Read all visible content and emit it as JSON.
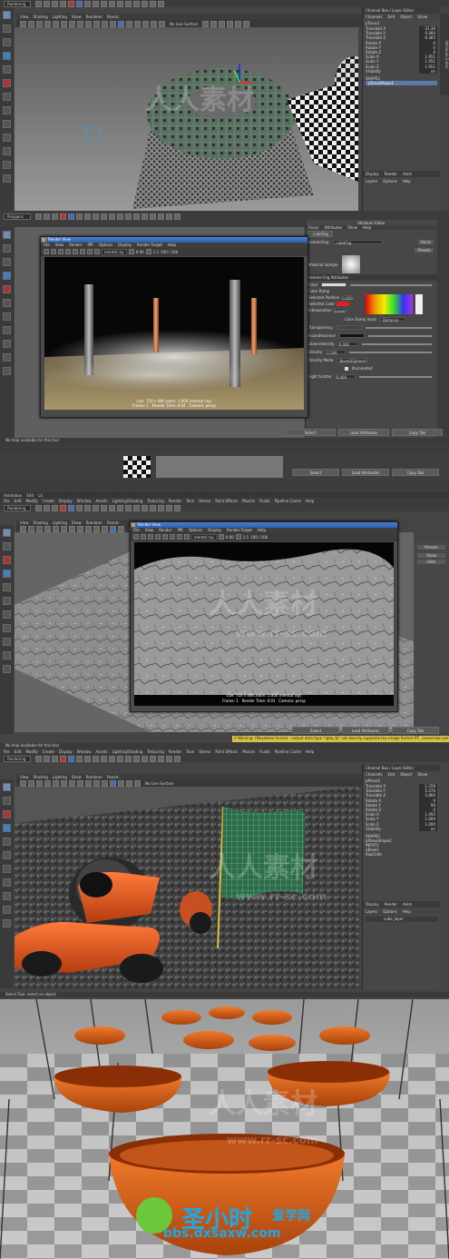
{
  "p1": {
    "mode": "Rendering",
    "menu": [
      "File",
      "Edit",
      "Modify",
      "Create",
      "Display",
      "Window",
      "Assets",
      "Select",
      "Mesh",
      "Edit Mesh",
      "Proxy",
      "Normals",
      "Color",
      "Create UVs",
      "Edit UVs",
      "Muscle",
      "Stereo",
      "Pipeline Cache",
      "Help"
    ],
    "viewmenu": [
      "View",
      "Shading",
      "Lighting",
      "Show",
      "Renderer",
      "Panels"
    ],
    "surface": "No Live Surface",
    "cb_title": "Channel Box / Layer Editor",
    "cb_tabs": [
      "Channels",
      "Edit",
      "Object",
      "Show"
    ],
    "cb_obj": "pTorus1",
    "channels": [
      {
        "n": "Translate X",
        "v": "-31.36"
      },
      {
        "n": "Translate Y",
        "v": "0.484"
      },
      {
        "n": "Translate Z",
        "v": "-0.365"
      },
      {
        "n": "Rotate X",
        "v": "0"
      },
      {
        "n": "Rotate Y",
        "v": "0"
      },
      {
        "n": "Rotate Z",
        "v": "0"
      },
      {
        "n": "Scale X",
        "v": "1.951"
      },
      {
        "n": "Scale Y",
        "v": "1.951"
      },
      {
        "n": "Scale Z",
        "v": "1.951"
      },
      {
        "n": "Visibility",
        "v": "on"
      }
    ],
    "shapes": "SHAPES",
    "shape_name": "pTorusShape1",
    "layer_tabs": [
      "Display",
      "Render",
      "Anim"
    ],
    "layer_menu": [
      "Layers",
      "Options",
      "Help"
    ],
    "sidetab": "Attribute Editor"
  },
  "p2": {
    "mode": "Polygons",
    "ae_title": "Attribute Editor",
    "ae_menu": [
      "Focus",
      "Attributes",
      "Show",
      "Help"
    ],
    "ae_tab": "cubeFog",
    "ae_node_label": "volumeFog:",
    "ae_node": "cubeFog",
    "ae_focus": "Focus",
    "ae_presets": "Presets",
    "ae_sample": "Material Sample",
    "ae_section": "Volume Fog Attributes",
    "ae_color_label": "Color",
    "ae_ramp": "Color Ramp",
    "ae_sel_pos_label": "Selected Position",
    "ae_sel_pos": "0.000",
    "ae_sel_col": "Selected Color",
    "ae_interp_label": "Interpolation",
    "ae_interp": "Linear",
    "ae_ramp_input_label": "Color Ramp Input",
    "ae_ramp_input": "Distance",
    "ae_transp": "Transparency",
    "ae_incand": "Incandescence",
    "ae_glow_label": "Glow Intensity",
    "ae_glow": "0.000",
    "ae_density_label": "Density",
    "ae_density": "2.500",
    "ae_dmode_label": "Density Mode",
    "ae_dmode": "Boxed(Sphere)",
    "ae_illum": "Illuminated",
    "ae_light_label": "Light Scatter",
    "ae_light": "0.000",
    "ae_buttons": [
      "Select",
      "Load Attributes",
      "Copy Tab"
    ],
    "rv_title": "Render View",
    "rv_menu": [
      "File",
      "View",
      "Render",
      "IPR",
      "Options",
      "Display",
      "Render Target",
      "Help"
    ],
    "rv_renderer": "mental ray",
    "rv_val": "0.00",
    "rv_ratio": "1:1",
    "rv_pct": "100 / 100",
    "rv_info": "size: 720 x 486 zoom: 1.000",
    "rv_engine": "(mental ray)",
    "rv_frame": "Frame: 1",
    "rv_time": "Render Time: 0:04",
    "rv_cam": "Camera: persp",
    "help": "No help available for this tool"
  },
  "p3": {
    "topmenu": [
      "Animation",
      "Edit",
      "Lit"
    ],
    "mode": "Rendering",
    "menu": [
      "File",
      "Edit",
      "Modify",
      "Create",
      "Display",
      "Window",
      "Assets",
      "Lighting/Shading",
      "Texturing",
      "Render",
      "Toon",
      "Stereo",
      "Paint Effects",
      "Muscle",
      "Fluids",
      "Pipeline Cache",
      "Help"
    ],
    "viewmenu": [
      "View",
      "Shading",
      "Lighting",
      "Show",
      "Renderer",
      "Panels"
    ],
    "surface": "No Live Surface",
    "rv_title": "Render View",
    "rv_menu": [
      "File",
      "View",
      "Render",
      "IPR",
      "Options",
      "Display",
      "Render Target",
      "Help"
    ],
    "rv_renderer": "mental ray",
    "rv_val": "0.00",
    "rv_ratio": "1:1",
    "rv_pct": "100 / 100",
    "rv_info": "size: 720 x 486 zoom: 1.000",
    "rv_engine": "(mental ray)",
    "rv_frame": "Frame: 1",
    "rv_time": "Render Time: 0:01",
    "rv_cam": "Camera: persp",
    "ae_buttons": [
      "Select",
      "Load Attributes",
      "Copy Tab"
    ],
    "warning": "// Warning: (Mayatomr.Scene) : output data type \"rgba_fp\" not directly supported by image format IFF, conversion performed",
    "help": "No help available for this tool",
    "presets": [
      "Presets",
      "Show",
      "Hide"
    ]
  },
  "p4": {
    "mode": "Rendering",
    "menu": [
      "File",
      "Edit",
      "Modify",
      "Create",
      "Display",
      "Window",
      "Assets",
      "Lighting/Shading",
      "Texturing",
      "Render",
      "Toon",
      "Stereo",
      "Paint Effects",
      "Muscle",
      "Fluids",
      "Pipeline Cache",
      "Help"
    ],
    "viewmenu": [
      "View",
      "Shading",
      "Lighting",
      "Show",
      "Renderer",
      "Panels"
    ],
    "surface": "No Live Surface",
    "cb_title": "Channel Box / Layer Editor",
    "cb_tabs": [
      "Channels",
      "Edit",
      "Object",
      "Show"
    ],
    "cb_obj": "pPlane2",
    "channels": [
      {
        "n": "Translate X",
        "v": "-1.259"
      },
      {
        "n": "Translate Y",
        "v": "5.476"
      },
      {
        "n": "Translate Z",
        "v": "5.860"
      },
      {
        "n": "Rotate X",
        "v": "0"
      },
      {
        "n": "Rotate Y",
        "v": "90"
      },
      {
        "n": "Rotate Z",
        "v": "0"
      },
      {
        "n": "Scale X",
        "v": "1.492"
      },
      {
        "n": "Scale Y",
        "v": "1.000"
      },
      {
        "n": "Scale Z",
        "v": "1.000"
      },
      {
        "n": "Visibility",
        "v": "on"
      }
    ],
    "shapes": "SHAPES",
    "shape_name": "pPlaneShape2",
    "inputs": "INPUTS",
    "input1": "nBase1",
    "input2": "flapCloth",
    "layer_tabs": [
      "Display",
      "Render",
      "Anim"
    ],
    "layer_menu": [
      "Layers",
      "Options",
      "Help"
    ],
    "layer_name": "cube_layer",
    "help": "Select Tool: select an object"
  },
  "watermark": {
    "brand": "人人素材",
    "url": "www.rr-sc.com",
    "logo_text": "圣小时",
    "logo_sub": "爱学网",
    "logo_url": "bbs.dxsaxw.com"
  }
}
